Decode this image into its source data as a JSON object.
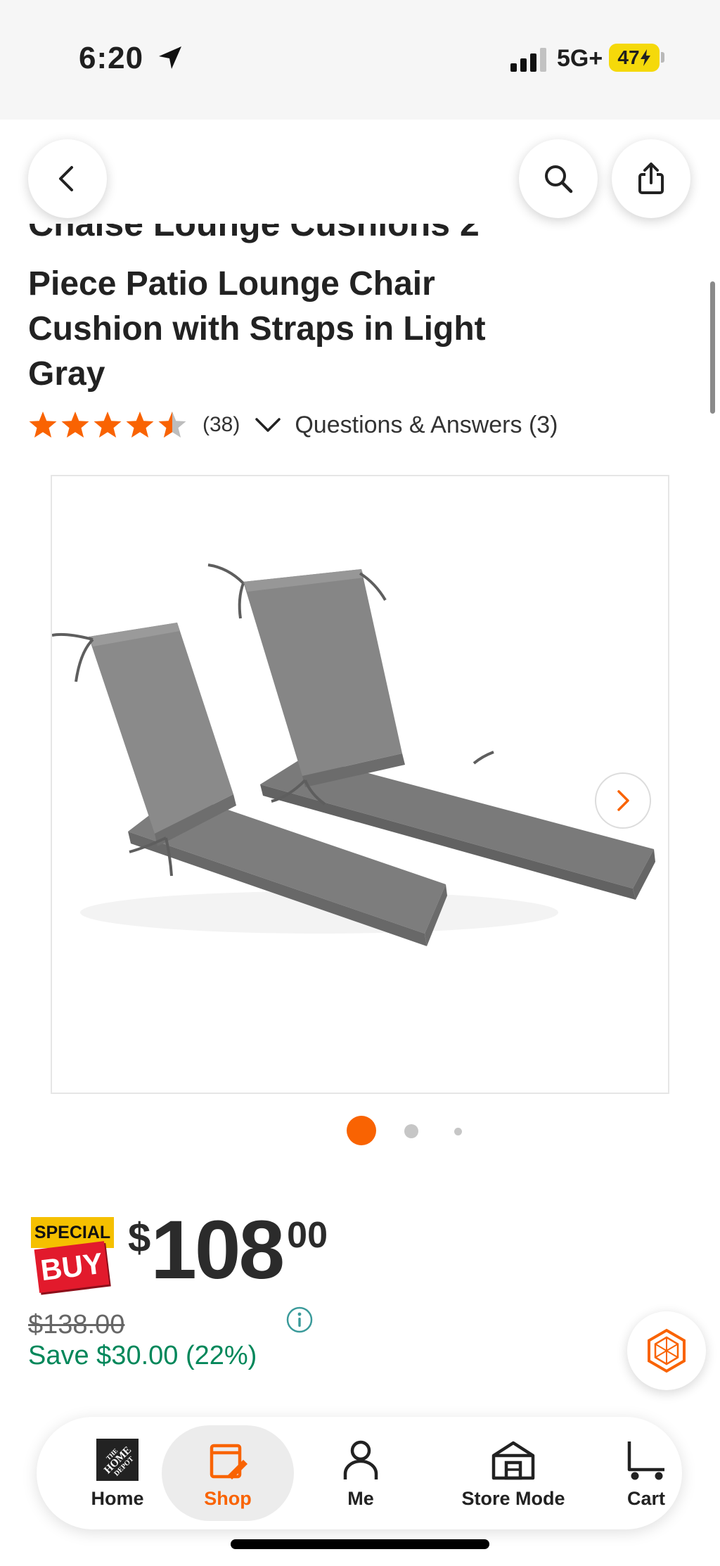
{
  "status_bar": {
    "time": "6:20",
    "network": "5G+",
    "battery": "47"
  },
  "header": {
    "back_icon": "chevron-left-icon",
    "search_icon": "search-icon",
    "share_icon": "share-icon"
  },
  "product": {
    "title_clipped": "Chaise Lounge Cushions 2",
    "title": "Piece Patio Lounge Chair Cushion with Straps in Light Gray",
    "rating": 4.5,
    "review_count": "(38)",
    "qa_link": "Questions & Answers (3)",
    "image_count": 3,
    "current_image": 1
  },
  "price": {
    "badge_top": "SPECIAL",
    "badge_bottom": "BUY",
    "currency": "$",
    "dollars": "108",
    "cents": "00",
    "was_price": "$138.00",
    "save_text": "Save $30.00 (22%)"
  },
  "bottom_nav": {
    "items": [
      {
        "label": "Home",
        "icon": "home-depot-logo-icon"
      },
      {
        "label": "Shop",
        "icon": "shop-icon",
        "active": true
      },
      {
        "label": "Me",
        "icon": "person-icon"
      },
      {
        "label": "Store Mode",
        "icon": "store-icon"
      },
      {
        "label": "Cart",
        "icon": "cart-icon"
      }
    ]
  },
  "colors": {
    "brand_orange": "#f96302",
    "save_green": "#00875a",
    "special_yellow": "#f5c000",
    "special_red": "#e21a2c"
  }
}
